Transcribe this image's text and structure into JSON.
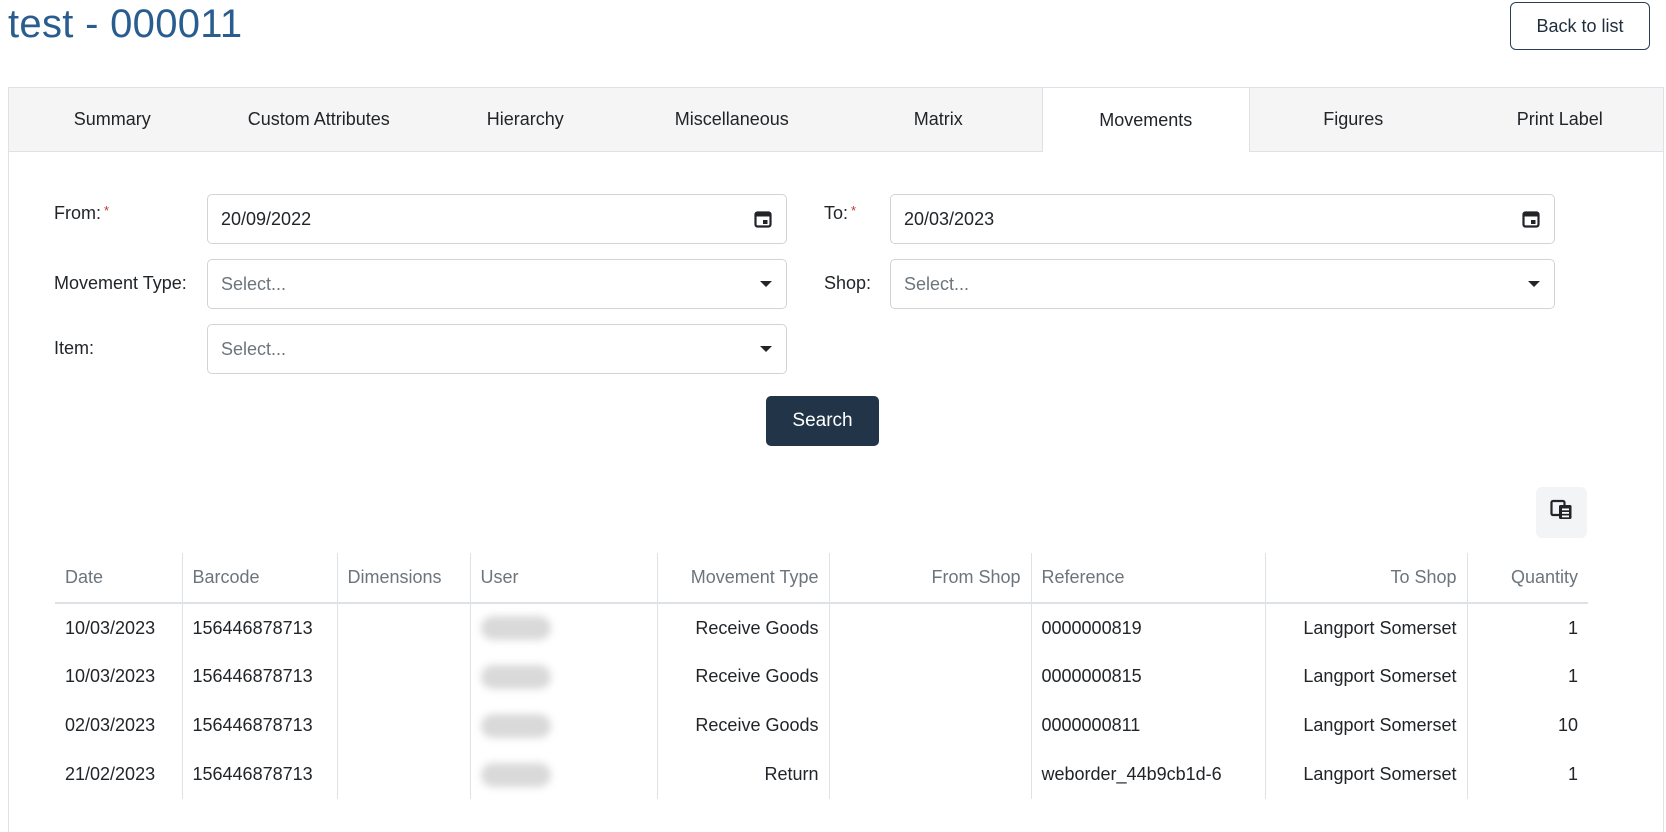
{
  "page": {
    "title": "test - 000011",
    "back_label": "Back to list"
  },
  "tabs": [
    "Summary",
    "Custom Attributes",
    "Hierarchy",
    "Miscellaneous",
    "Matrix",
    "Movements",
    "Figures",
    "Print Label"
  ],
  "active_tab": "Movements",
  "filters": {
    "from": {
      "label": "From:",
      "required_mark": "*",
      "value": "20/09/2022",
      "icon": "calendar-icon"
    },
    "to": {
      "label": "To:",
      "required_mark": "*",
      "value": "20/03/2023",
      "icon": "calendar-icon"
    },
    "movement_type": {
      "label": "Movement Type:",
      "placeholder": "Select...",
      "icon": "chevron-down-icon"
    },
    "shop": {
      "label": "Shop:",
      "placeholder": "Select...",
      "icon": "chevron-down-icon"
    },
    "item": {
      "label": "Item:",
      "placeholder": "Select...",
      "icon": "chevron-down-icon"
    },
    "search_label": "Search"
  },
  "column_toggle_icon": "column-chooser-icon",
  "table": {
    "headers": [
      "Date",
      "Barcode",
      "Dimensions",
      "User",
      "Movement Type",
      "From Shop",
      "Reference",
      "To Shop",
      "Quantity"
    ],
    "rows": [
      [
        "10/03/2023",
        "156446878713",
        "",
        "",
        "Receive Goods",
        "",
        "0000000819",
        "Langport Somerset",
        "1"
      ],
      [
        "10/03/2023",
        "156446878713",
        "",
        "",
        "Receive Goods",
        "",
        "0000000815",
        "Langport Somerset",
        "1"
      ],
      [
        "02/03/2023",
        "156446878713",
        "",
        "",
        "Receive Goods",
        "",
        "0000000811",
        "Langport Somerset",
        "10"
      ],
      [
        "21/02/2023",
        "156446878713",
        "",
        "",
        "Return",
        "",
        "weborder_44b9cb1d-6",
        "Langport Somerset",
        "1"
      ]
    ]
  },
  "colors": {
    "title": "#2a5d8f",
    "primary_button": "#213448",
    "required": "#c0392b"
  }
}
